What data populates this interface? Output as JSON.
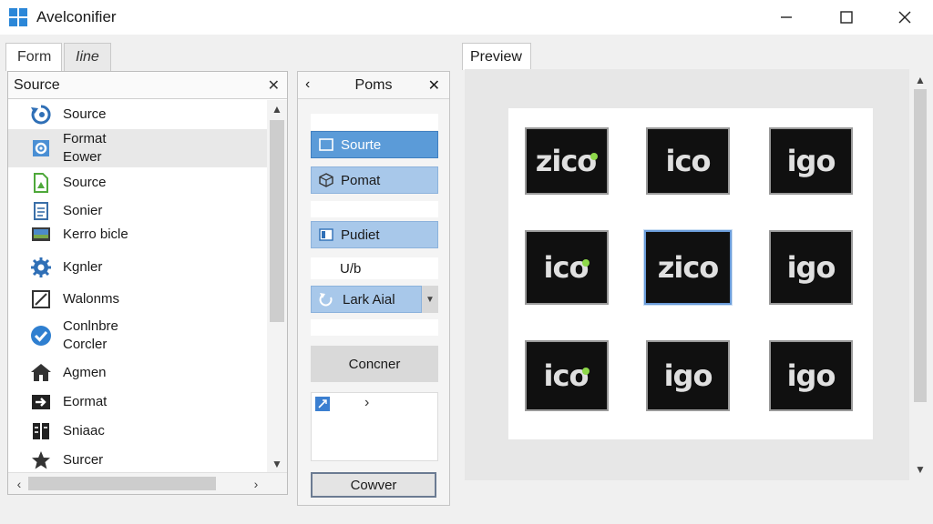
{
  "window": {
    "title": "Avelconifier",
    "minimize_icon": "minimize-icon",
    "maximize_icon": "maximize-icon",
    "close_icon": "close-icon"
  },
  "tabs": [
    {
      "label": "Form",
      "active": true
    },
    {
      "label": "Iine",
      "active": false
    }
  ],
  "preview_tab": {
    "label": "Preview"
  },
  "source_panel": {
    "title": "Source",
    "close": "✕",
    "items": [
      {
        "label": "Source",
        "icon": "refresh-icon"
      },
      {
        "label": "Format\nEower",
        "icon": "gear-doc-icon",
        "selected": true
      },
      {
        "label": "Source",
        "icon": "file-icon"
      },
      {
        "label": "Sonier",
        "icon": "document-icon"
      },
      {
        "label": "Kerro bicle",
        "icon": "monitor-icon"
      },
      {
        "label": "Kgnler",
        "icon": "gear-icon"
      },
      {
        "label": "Walonms",
        "icon": "frame-icon"
      },
      {
        "label": "Conlnbre\nCorcler",
        "icon": "check-badge-icon"
      },
      {
        "label": "Agmen",
        "icon": "home-icon"
      },
      {
        "label": "Eormat",
        "icon": "export-icon"
      },
      {
        "label": "Sniaac",
        "icon": "archive-icon"
      },
      {
        "label": "Surcer",
        "icon": "star-icon"
      }
    ]
  },
  "mid_panel": {
    "title": "Poms",
    "back": "‹",
    "close": "✕",
    "source_button": "Sourte",
    "format_button": "Pomat",
    "pudiet_button": "Pudiet",
    "field_value": "U/b",
    "dropdown_value": "Lark Aial",
    "big_button": "Concner",
    "box_chevron": "›",
    "bottom_button": "Cowver"
  },
  "preview": {
    "tiles": [
      {
        "text": "zico",
        "selected": false
      },
      {
        "text": "ico",
        "selected": false
      },
      {
        "text": "igo",
        "selected": false
      },
      {
        "text": "ico",
        "selected": false
      },
      {
        "text": "zico",
        "selected": true
      },
      {
        "text": "igo",
        "selected": false
      },
      {
        "text": "ico",
        "selected": false
      },
      {
        "text": "igo",
        "selected": false
      },
      {
        "text": "igo",
        "selected": false
      }
    ]
  },
  "colors": {
    "accent": "#5b9bd8",
    "accent_light": "#a8c8ea",
    "selection": "#6a9bd8"
  }
}
